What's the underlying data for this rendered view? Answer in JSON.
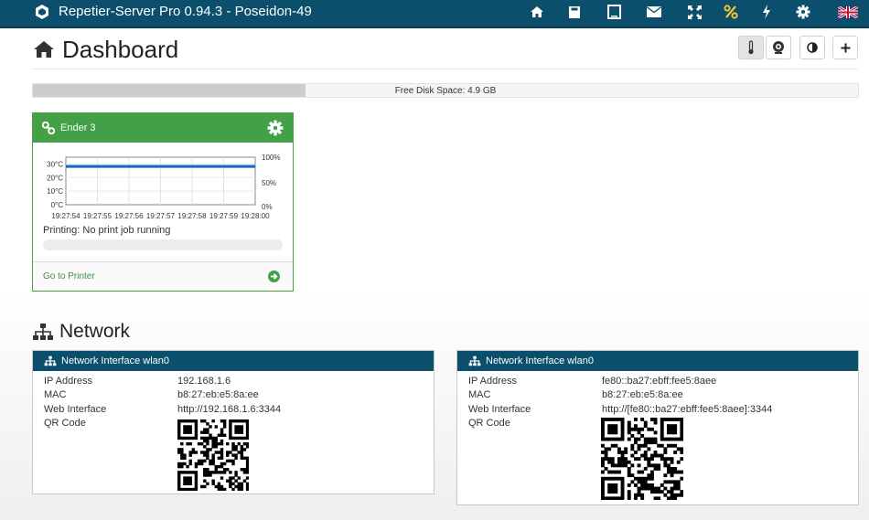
{
  "app": {
    "title": "Repetier-Server Pro 0.94.3 - Poseidon-49",
    "nav_icons": [
      "home-icon",
      "sd-card-icon",
      "tablet-icon",
      "envelope-icon",
      "fullscreen-icon",
      "percent-icon",
      "bolt-icon",
      "gear-icon",
      "uk-flag-icon"
    ],
    "accent": "#0b4f6c"
  },
  "dashboard": {
    "title": "Dashboard"
  },
  "disk": {
    "label": "Free Disk Space: 4.9 GB",
    "used_fraction": 0.33
  },
  "printer": {
    "name": "Ender 3",
    "status": "Printing: No print job running",
    "go_label": "Go to Printer",
    "color": "#43a047",
    "chart_data": {
      "type": "line",
      "y_left_ticks": [
        "30°C",
        "20°C",
        "10°C",
        "0°C"
      ],
      "y_right_ticks": [
        "100%",
        "50%",
        "0%"
      ],
      "x_ticks": [
        "19:27:54",
        "19:27:55",
        "19:27:56",
        "19:27:57",
        "19:27:58",
        "19:27:59",
        "19:28:00"
      ],
      "ylim": [
        0,
        35
      ],
      "series": [
        {
          "values": [
            29,
            29,
            29,
            29,
            29,
            29,
            29
          ]
        },
        {
          "values": [
            28,
            28,
            28,
            28,
            28,
            28,
            28
          ]
        }
      ]
    }
  },
  "network": {
    "title": "Network",
    "interfaces": [
      {
        "title": "Network Interface wlan0",
        "rows": [
          {
            "key": "IP Address",
            "value": "192.168.1.6"
          },
          {
            "key": "MAC",
            "value": "b8:27:eb:e5:8a:ee"
          },
          {
            "key": "Web Interface",
            "value": "http://192.168.1.6:3344"
          },
          {
            "key": "QR Code",
            "value": ""
          }
        ]
      },
      {
        "title": "Network Interface wlan0",
        "rows": [
          {
            "key": "IP Address",
            "value": "fe80::ba27:ebff:fee5:8aee"
          },
          {
            "key": "MAC",
            "value": "b8:27:eb:e5:8a:ee"
          },
          {
            "key": "Web Interface",
            "value": "http://[fe80::ba27:ebff:fee5:8aee]:3344"
          },
          {
            "key": "QR Code",
            "value": ""
          }
        ]
      }
    ]
  }
}
